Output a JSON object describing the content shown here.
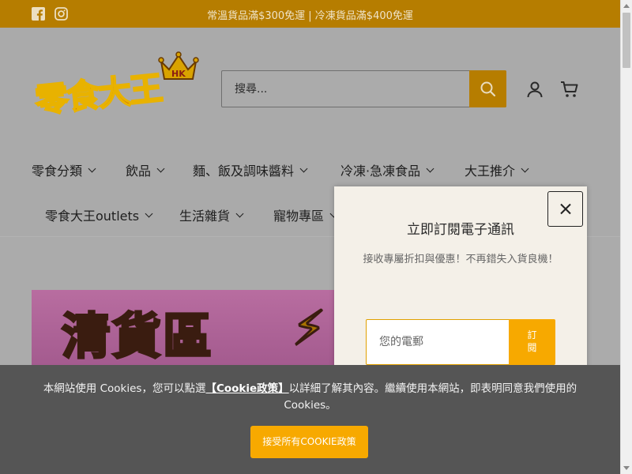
{
  "announcement": "常溫貨品滿$300免運 | 冷凍貨品滿$400免運",
  "social": [
    "facebook-icon",
    "instagram-icon"
  ],
  "logo": {
    "text": "零食大王",
    "badge": "HK"
  },
  "search": {
    "placeholder": "搜尋..."
  },
  "nav": {
    "row1": [
      "零食分類",
      "飲品",
      "麵、飯及調味醬料",
      "冷凍·急凍食品",
      "大王推介"
    ],
    "row2": [
      "零食大王outlets",
      "生活雜貨",
      "寵物專區"
    ]
  },
  "banner": {
    "text": "清貨區",
    "mark": "⚡"
  },
  "popup": {
    "title": "立即訂閱電子通訊",
    "description": "接收專屬折扣與優惠！不再錯失入貨良機！",
    "email_placeholder": "您的電郵",
    "subscribe_label": "訂閱"
  },
  "cookie": {
    "text_before": "本網站使用 Cookies，您可以點選",
    "link": "【Cookie政策】",
    "text_after": "以詳細了解其內容。繼續使用本網站，即表明同意我們使用的 Cookies。",
    "accept_label": "接受所有COOKIE政策"
  },
  "colors": {
    "brand": "#f7a900",
    "bar": "#b67d00",
    "overlay": "#555555"
  }
}
